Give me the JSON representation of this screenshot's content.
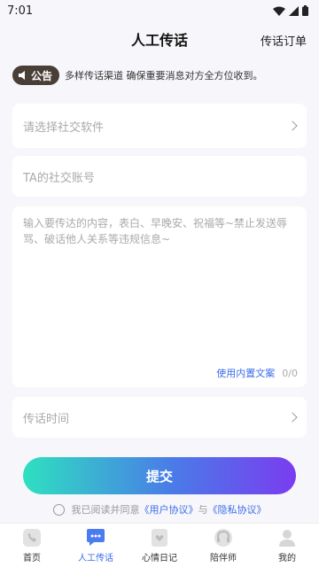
{
  "status_bar": {
    "time": "7:01"
  },
  "header": {
    "title": "人工传话",
    "right_link": "传话订单"
  },
  "notice": {
    "badge": "公告",
    "text": "多样传话渠道 确保重要消息对方全方位收到。"
  },
  "form": {
    "social_placeholder": "请选择社交软件",
    "account_placeholder": "TA的社交账号",
    "content_placeholder": "输入要传达的内容，表白、早晚安、祝福等~禁止发送辱骂、破话他人关系等违规信息~",
    "template_link": "使用内置文案",
    "counter": "0/0",
    "time_placeholder": "传话时间"
  },
  "submit": {
    "label": "提交"
  },
  "agreement": {
    "prefix": "我已阅读并同意",
    "user_agreement": "《用户协议》",
    "and": "与",
    "privacy_agreement": "《隐私协议》"
  },
  "tabbar": {
    "items": [
      {
        "label": "首页",
        "icon": "phone-icon"
      },
      {
        "label": "人工传话",
        "icon": "chat-icon"
      },
      {
        "label": "心情日记",
        "icon": "heart-diary-icon"
      },
      {
        "label": "陪伴师",
        "icon": "headset-icon"
      },
      {
        "label": "我的",
        "icon": "user-icon"
      }
    ],
    "active_index": 1
  },
  "colors": {
    "accent": "#3b6de8",
    "gradient_start": "#2ee0c0",
    "gradient_end": "#7a3cf0",
    "notice_badge": "#4a3f36"
  }
}
